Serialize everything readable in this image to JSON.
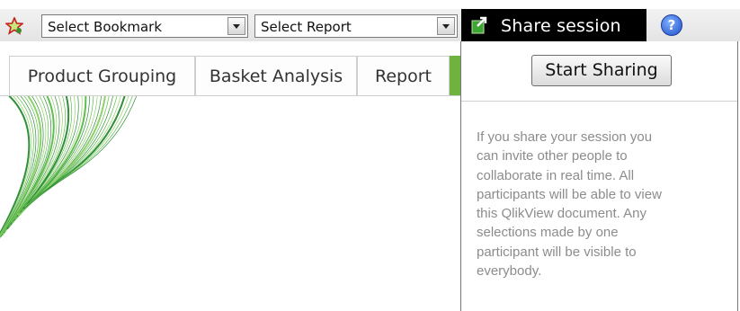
{
  "toolbar": {
    "bookmark_icon": "star-icon",
    "bookmark_select": {
      "value": "Select Bookmark"
    },
    "report_select": {
      "value": "Select Report"
    },
    "share": {
      "label": "Share session",
      "icon": "share-session-icon"
    },
    "help": {
      "icon": "help-icon",
      "glyph": "?"
    }
  },
  "tabs": [
    {
      "label": "Product Grouping"
    },
    {
      "label": "Basket Analysis"
    },
    {
      "label": "Report"
    }
  ],
  "share_panel": {
    "start_label": "Start Sharing",
    "description": "If you share your session you\ncan invite other people to\ncollaborate in real time. All\nparticipants will be able to view\nthis QlikView document. Any\nselections made by one\nparticipant will be visible to\neverybody."
  },
  "colors": {
    "accent_green": "#6fb23d",
    "share_bg": "#000000",
    "help_blue": "#1f4fc8",
    "description_text": "#8c8c8c"
  }
}
